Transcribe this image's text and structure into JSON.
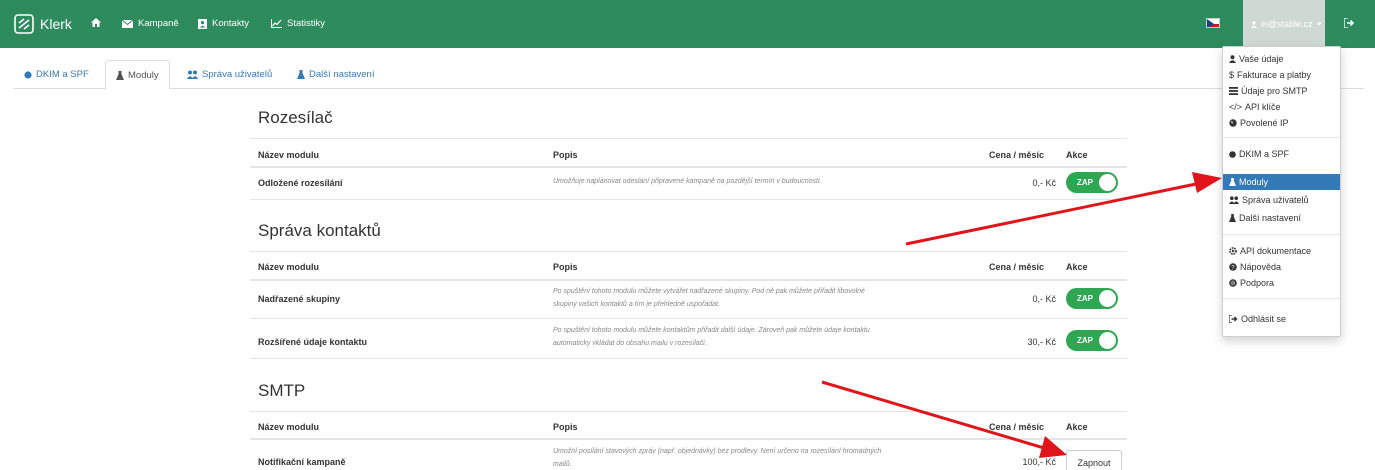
{
  "brand": {
    "name": "Klerk"
  },
  "nav": {
    "home_icon": "home-icon",
    "items": [
      {
        "label": "Kampaně",
        "icon": "envelope-icon"
      },
      {
        "label": "Kontakty",
        "icon": "contacts-icon"
      },
      {
        "label": "Statistiky",
        "icon": "chart-icon"
      }
    ],
    "flag": "czech-flag",
    "user": "in@stable.cz"
  },
  "tabs": [
    {
      "label": "DKIM a SPF",
      "icon": "dot-icon",
      "active": false
    },
    {
      "label": "Moduly",
      "icon": "flask-icon",
      "active": true
    },
    {
      "label": "Správa uživatelů",
      "icon": "users-icon",
      "active": false
    },
    {
      "label": "Další nastavení",
      "icon": "flask-icon",
      "active": false
    }
  ],
  "table_headers": {
    "name": "Název modulu",
    "desc": "Popis",
    "price": "Cena / měsíc",
    "action": "Akce"
  },
  "sections": [
    {
      "title": "Rozesílač",
      "rows": [
        {
          "name": "Odložené rozesílání",
          "desc": "Umožňuje naplánovat odeslání připravené kampaně na pozdější termín v budoucnosti.",
          "price": "0,- Kč",
          "toggle": "ZAP"
        }
      ]
    },
    {
      "title": "Správa kontaktů",
      "rows": [
        {
          "name": "Nadřazené skupiny",
          "desc": "Po spuštění tohoto modulu můžete vytvářet nadřazené skupiny. Pod ně pak můžete přiřadit libovolné skupiny vašich kontaktů a tím je přehledně uspořádat.",
          "price": "0,- Kč",
          "toggle": "ZAP"
        },
        {
          "name": "Rozšířené údaje kontaktu",
          "desc": "Po spuštění tohoto modulu můžete kontaktům přiřadit další údaje. Zároveň pak můžete údaje kontaktu automaticky vkládat do obsahu mailu v rozesílači.",
          "price": "30,- Kč",
          "toggle": "ZAP"
        }
      ]
    },
    {
      "title": "SMTP",
      "rows": [
        {
          "name": "Notifikační kampaně",
          "desc": "Umožní posílání stavových zpráv (např. objednávky) bez prodlevy. Není určeno na rozesílání hromadných mailů.",
          "price": "100,- Kč",
          "button": "Zapnout"
        }
      ]
    }
  ],
  "dropdown": {
    "items": [
      {
        "label": "Vaše údaje",
        "icon": "user-icon"
      },
      {
        "label": "Fakturace a platby",
        "icon": "dollar-icon"
      },
      {
        "label": "Údaje pro SMTP",
        "icon": "list-icon"
      },
      {
        "label": "API klíče",
        "icon": "code-icon"
      },
      {
        "label": "Povolené IP",
        "icon": "globe-icon"
      },
      {
        "label": "DKIM a SPF",
        "icon": "dot-icon"
      },
      {
        "label": "Moduly",
        "icon": "flask-icon",
        "active": true
      },
      {
        "label": "Správa uživatelů",
        "icon": "users-icon"
      },
      {
        "label": "Další nastavení",
        "icon": "flask-icon"
      },
      {
        "label": "API dokumentace",
        "icon": "gear-icon"
      },
      {
        "label": "Nápověda",
        "icon": "question-icon"
      },
      {
        "label": "Podpora",
        "icon": "lifebuoy-icon"
      },
      {
        "label": "Odhlásit se",
        "icon": "logout-icon"
      }
    ]
  },
  "colors": {
    "navbar": "#2e8b5e",
    "toggle_on": "#2fa652",
    "link": "#337ab7",
    "arrow": "#e0151c"
  }
}
